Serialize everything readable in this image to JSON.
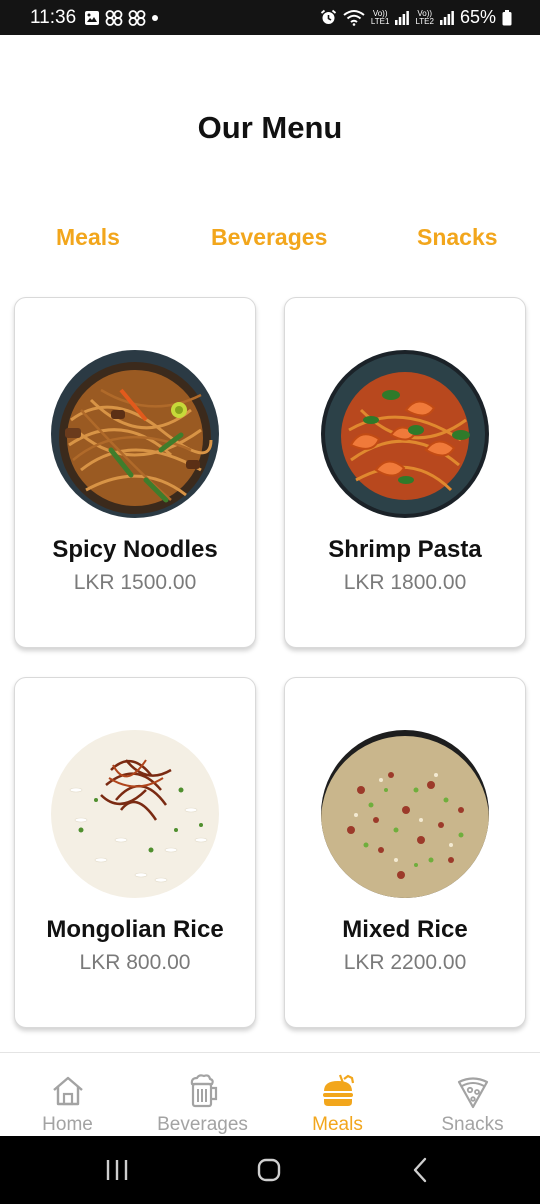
{
  "status_bar": {
    "time": "11:36",
    "battery": "65%",
    "lte1": "LTE1",
    "lte2": "LTE2",
    "volte": "Vo))"
  },
  "header": {
    "title": "Our Menu"
  },
  "category_tabs": [
    {
      "label": "Meals"
    },
    {
      "label": "Beverages"
    },
    {
      "label": "Snacks"
    }
  ],
  "items": [
    {
      "name": "Spicy Noodles",
      "price": "LKR 1500.00",
      "image": "spicy-noodles-photo"
    },
    {
      "name": "Shrimp Pasta",
      "price": "LKR 1800.00",
      "image": "shrimp-pasta-photo"
    },
    {
      "name": "Mongolian Rice",
      "price": "LKR 800.00",
      "image": "mongolian-rice-photo"
    },
    {
      "name": "Mixed Rice",
      "price": "LKR 2200.00",
      "image": "mixed-rice-photo"
    }
  ],
  "bottom_nav": [
    {
      "label": "Home",
      "icon": "home-icon",
      "active": false
    },
    {
      "label": "Beverages",
      "icon": "beer-mug-icon",
      "active": false
    },
    {
      "label": "Meals",
      "icon": "burger-icon",
      "active": true
    },
    {
      "label": "Snacks",
      "icon": "pizza-slice-icon",
      "active": false
    }
  ],
  "colors": {
    "accent": "#f2a61c",
    "inactive": "#a3a3a3",
    "price": "#7a7a7a"
  }
}
